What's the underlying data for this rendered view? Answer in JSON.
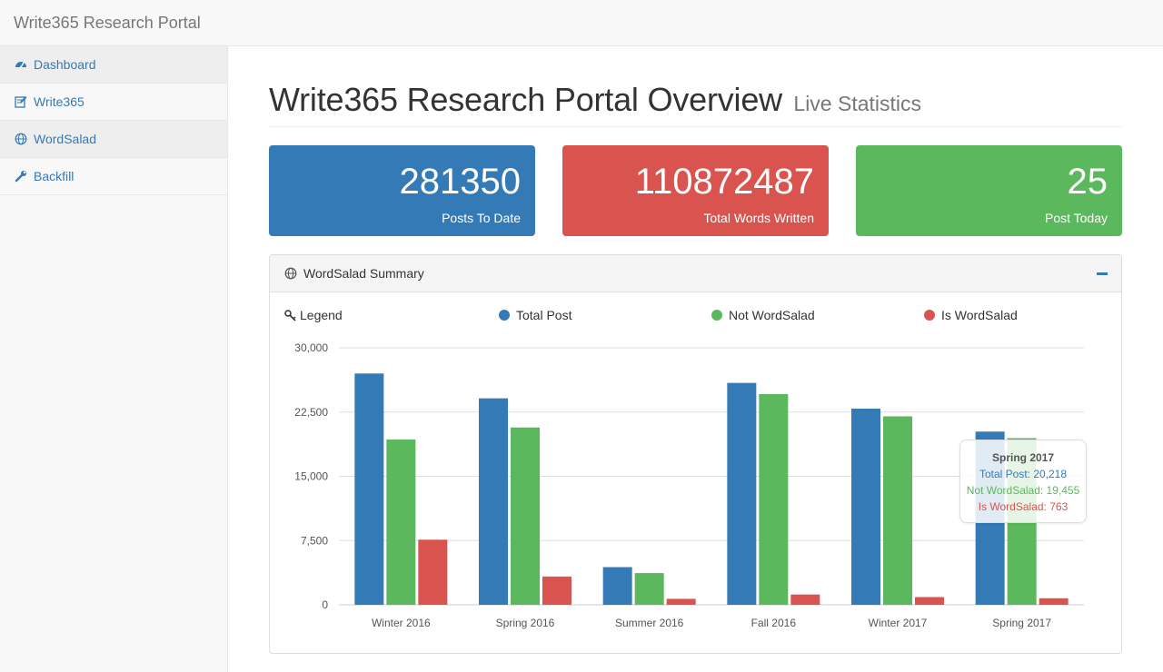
{
  "navbar": {
    "brand": "Write365 Research Portal"
  },
  "sidebar": {
    "items": [
      {
        "label": "Dashboard",
        "icon": "dashboard-icon"
      },
      {
        "label": "Write365",
        "icon": "edit-icon"
      },
      {
        "label": "WordSalad",
        "icon": "globe-icon"
      },
      {
        "label": "Backfill",
        "icon": "wrench-icon"
      }
    ]
  },
  "header": {
    "title": "Write365 Research Portal Overview",
    "subtitle": "Live Statistics"
  },
  "stats": [
    {
      "value": "281350",
      "label": "Posts To Date",
      "color": "#337ab7"
    },
    {
      "value": "110872487",
      "label": "Total Words Written",
      "color": "#d9534f"
    },
    {
      "value": "25",
      "label": "Post Today",
      "color": "#5cb85c"
    }
  ],
  "panel": {
    "title": "WordSalad Summary"
  },
  "legend": {
    "title": "Legend",
    "items": [
      {
        "label": "Total Post",
        "color": "#337ab7"
      },
      {
        "label": "Not WordSalad",
        "color": "#5cb85c"
      },
      {
        "label": "Is WordSalad",
        "color": "#d9534f"
      }
    ]
  },
  "chart_data": {
    "type": "bar",
    "categories": [
      "Winter 2016",
      "Spring 2016",
      "Summer 2016",
      "Fall 2016",
      "Winter 2017",
      "Spring 2017"
    ],
    "series": [
      {
        "name": "Total Post",
        "color": "#337ab7",
        "values": [
          27000,
          24100,
          4400,
          25900,
          22900,
          20218
        ]
      },
      {
        "name": "Not WordSalad",
        "color": "#5cb85c",
        "values": [
          19300,
          20700,
          3700,
          24600,
          22000,
          19455
        ]
      },
      {
        "name": "Is WordSalad",
        "color": "#d9534f",
        "values": [
          7600,
          3300,
          700,
          1200,
          900,
          763
        ]
      }
    ],
    "yticks": [
      "0",
      "7,500",
      "15,000",
      "22,500",
      "30,000"
    ],
    "ylim": [
      0,
      30000
    ],
    "grid": true
  },
  "tooltip": {
    "title": "Spring 2017",
    "lines": [
      "Total Post: 20,218",
      "Not WordSalad: 19,455",
      "Is WordSalad: 763"
    ]
  }
}
